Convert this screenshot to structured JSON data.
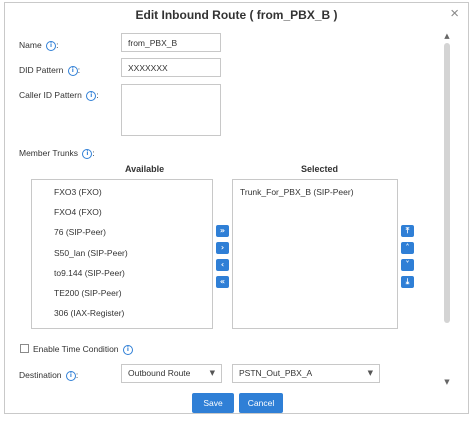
{
  "dialog": {
    "title": "Edit Inbound Route ( from_PBX_B )",
    "close_glyph": "×"
  },
  "form": {
    "name_label": "Name",
    "name_value": "from_PBX_B",
    "did_label": "DID Pattern",
    "did_value": "XXXXXXX",
    "callerid_label": "Caller ID Pattern",
    "callerid_value": "",
    "member_trunks_label": "Member Trunks",
    "info_glyph": "i"
  },
  "trunks": {
    "available_header": "Available",
    "selected_header": "Selected",
    "available": [
      "FXO3 (FXO)",
      "FXO4 (FXO)",
      "76 (SIP-Peer)",
      "S50_lan (SIP-Peer)",
      "to9.144 (SIP-Peer)",
      "TE200 (SIP-Peer)",
      "306 (IAX-Register)"
    ],
    "selected": [
      "Trunk_For_PBX_B (SIP-Peer)"
    ],
    "move_buttons": {
      "add_all": "»",
      "add": "›",
      "remove": "‹",
      "remove_all": "«"
    },
    "order_buttons": {
      "top": "⤒",
      "up": "˄",
      "down": "˅",
      "bottom": "⤓"
    }
  },
  "time_condition": {
    "label": "Enable Time Condition",
    "checked": false
  },
  "destination": {
    "label": "Destination",
    "type_value": "Outbound Route",
    "target_value": "PSTN_Out_PBX_A",
    "caret_glyph": "▼"
  },
  "buttons": {
    "save": "Save",
    "cancel": "Cancel"
  },
  "scrollbar": {
    "up_glyph": "▲",
    "down_glyph": "▼"
  },
  "colors": {
    "accent": "#2f7fd6",
    "border": "#c8c8c8"
  }
}
